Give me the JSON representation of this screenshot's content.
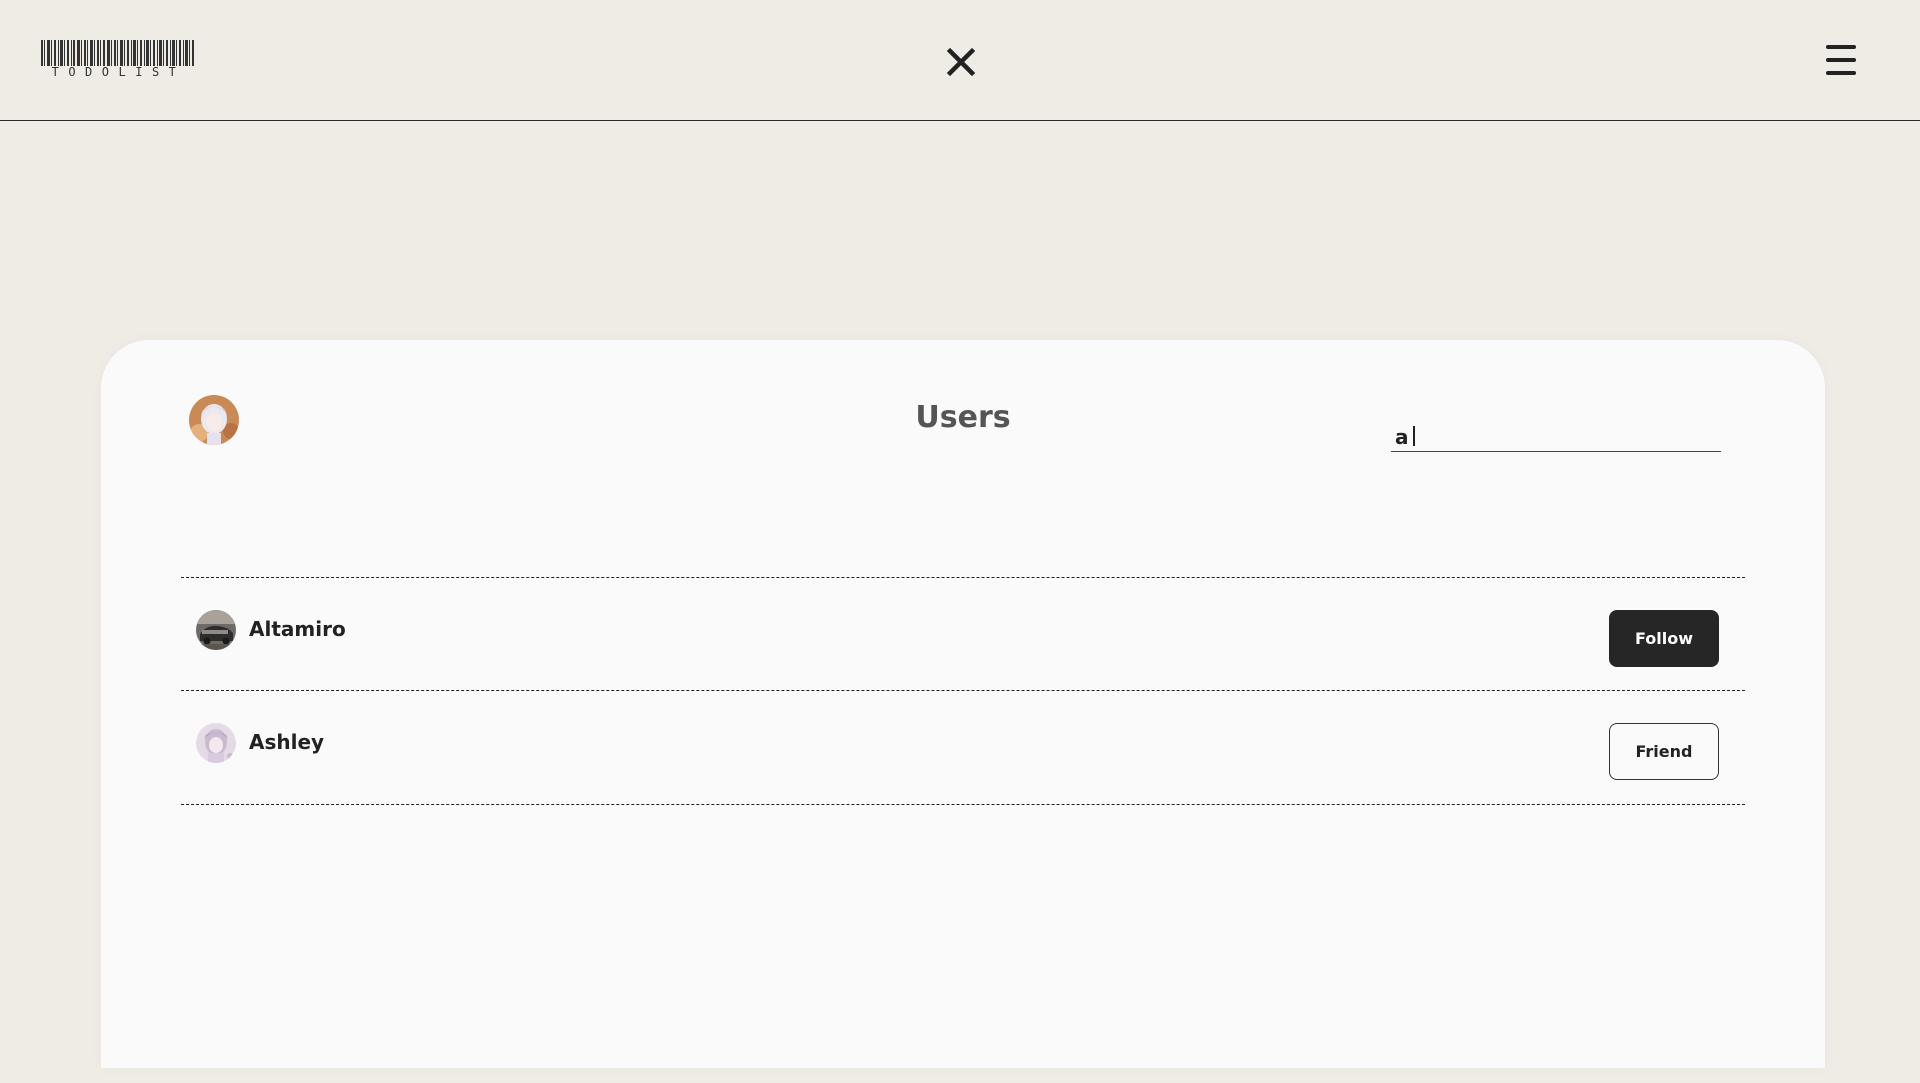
{
  "app": {
    "logo_text": "TODOLIST"
  },
  "header": {
    "close_icon": "close-icon",
    "menu_icon": "hamburger-menu-icon"
  },
  "users_panel": {
    "title": "Users",
    "search": {
      "value": "a",
      "placeholder": ""
    },
    "users": [
      {
        "name": "Altamiro",
        "action_label": "Follow",
        "action_style": "filled"
      },
      {
        "name": "Ashley",
        "action_label": "Friend",
        "action_style": "outline"
      }
    ]
  },
  "colors": {
    "background": "#efece6",
    "card": "#fafafa",
    "follow_button": "#262626",
    "text_dark": "#222222",
    "title_gray": "#555555"
  }
}
